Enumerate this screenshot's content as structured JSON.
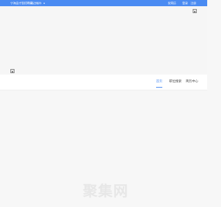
{
  "topbar": {
    "site_name": "宁海县才智招聘网",
    "region": "周边城市",
    "resume": "发简历",
    "login": "登录",
    "register": "注册"
  },
  "nav": {
    "items": [
      {
        "label": "首页",
        "active": true
      },
      {
        "label": "职位搜索",
        "active": false
      },
      {
        "label": "简历中心",
        "active": false
      }
    ]
  },
  "watermark": {
    "text": "聚集网"
  },
  "colors": {
    "accent": "#4a8bf2",
    "background": "#f7f7f7",
    "watermark": "#e7e7e7"
  },
  "icons": {
    "banner_top_right": "broken-image-icon",
    "banner_bottom_left": "broken-image-icon"
  }
}
